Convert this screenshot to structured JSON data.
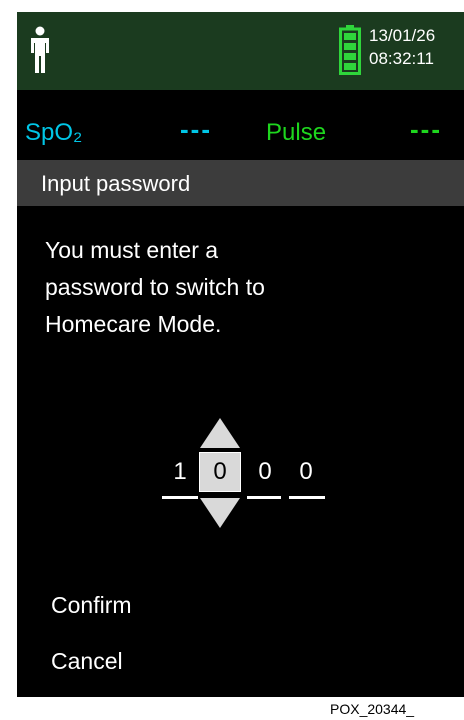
{
  "status": {
    "date": "13/01/26",
    "time": "08:32:11",
    "person_icon": "person-icon",
    "battery_icon": "battery-full-icon",
    "battery_color": "#2fd63b"
  },
  "vitals": {
    "spo2_label": "SpO₂",
    "spo2_value": "---",
    "pulse_label": "Pulse",
    "pulse_value": "---",
    "spo2_color": "#00c6e6",
    "pulse_color": "#1ed61e"
  },
  "dialog": {
    "title": "Input password",
    "message_lines": [
      "You must enter a",
      "password to switch to",
      "Homecare Mode."
    ],
    "digits": [
      "1",
      "0",
      "0",
      "0"
    ],
    "up_icon": "arrow-up-icon",
    "down_icon": "arrow-down-icon",
    "confirm_label": "Confirm",
    "cancel_label": "Cancel"
  },
  "figure_id": "POX_20344_"
}
